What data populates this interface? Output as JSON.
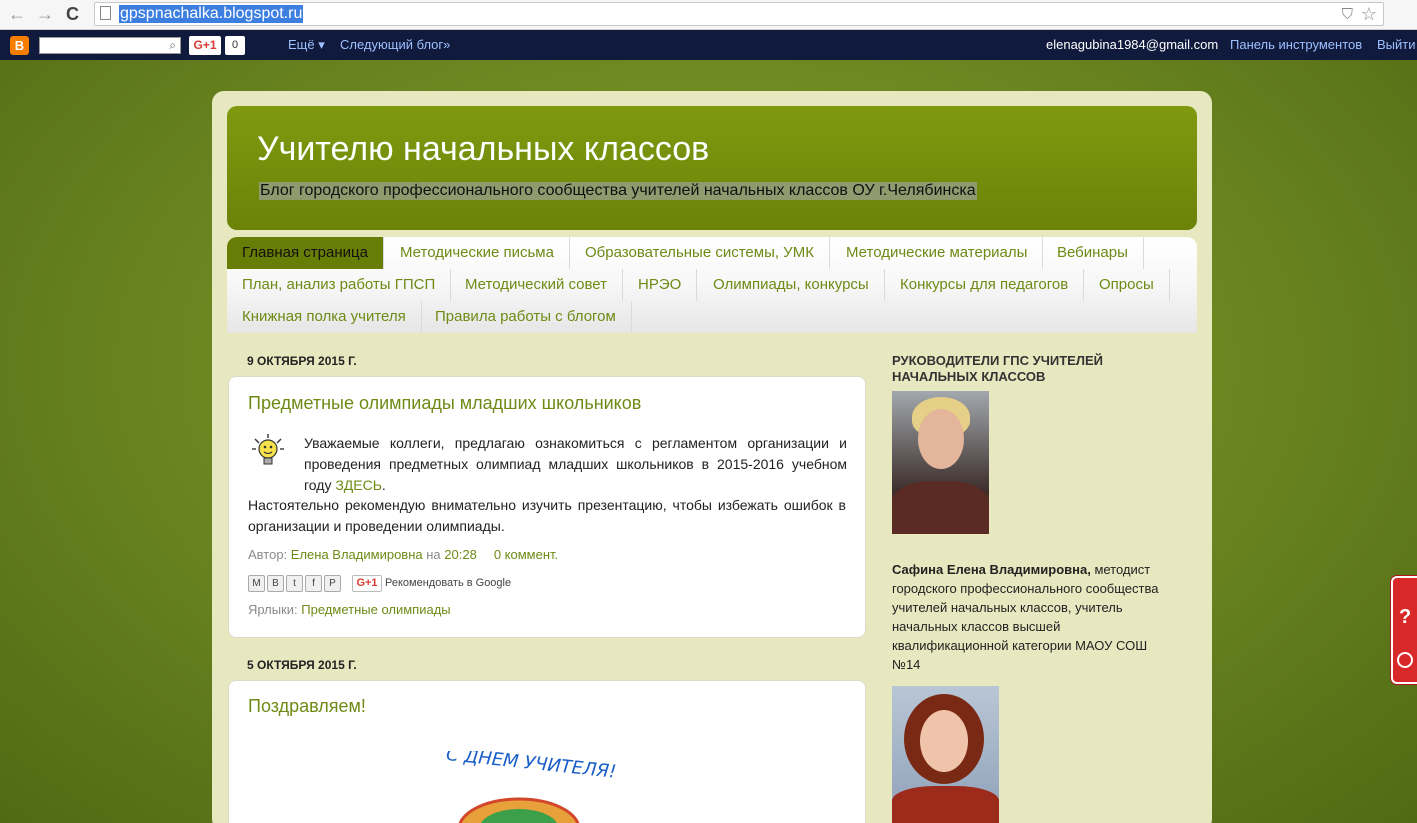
{
  "browser": {
    "url": "gpspnachalka.blogspot.ru",
    "back_icon": "←",
    "forward_icon": "→",
    "reload_icon": "C",
    "shield_icon": "⛉",
    "star_icon": "☆"
  },
  "navbar": {
    "logo": "B",
    "gplus": "G+1",
    "gcount": "0",
    "more": "Ещё ▾",
    "next_blog": "Следующий блог»",
    "email": "elenagubina1984@gmail.com",
    "dashboard": "Панель инструментов",
    "logout": "Выйти"
  },
  "header": {
    "title": "Учителю начальных классов",
    "description": "Блог городского профессионального сообщества учителей начальных классов ОУ г.Челябинска"
  },
  "tabs": [
    {
      "label": "Главная страница"
    },
    {
      "label": "Методические письма"
    },
    {
      "label": "Образовательные системы, УМК"
    },
    {
      "label": "Методические материалы"
    },
    {
      "label": "Вебинары"
    },
    {
      "label": "План, анализ работы ГПСП"
    },
    {
      "label": "Методический совет"
    },
    {
      "label": "НРЭО"
    },
    {
      "label": "Олимпиады, конкурсы"
    },
    {
      "label": "Конкурсы для педагогов"
    },
    {
      "label": "Опросы"
    },
    {
      "label": "Книжная полка учителя"
    },
    {
      "label": "Правила работы с блогом"
    }
  ],
  "posts": [
    {
      "date": "9 ОКТЯБРЯ 2015 Г.",
      "title": "Предметные олимпиады младших школьников",
      "p1": "Уважаемые коллеги, предлагаю ознакомиться с регламентом организации и проведения предметных олимпиад младших школьников в 2015-2016 учебном году ",
      "p1_link": "ЗДЕСЬ",
      "p1_end": ".",
      "p2": "Настоятельно рекомендую внимательно изучить презентацию, чтобы избежать ошибок в организации и проведении олимпиады.",
      "author_prefix": "Автор: ",
      "author": "Елена Владимировна",
      "at": " на ",
      "time": "20:28",
      "comments": "0 коммент.",
      "share_icons": [
        "M",
        "B",
        "t",
        "f",
        "P"
      ],
      "gplus": "G+1",
      "recommend": "Рекомендовать в Google",
      "labels_prefix": "Ярлыки: ",
      "label": "Предметные олимпиады"
    },
    {
      "date": "5 ОКТЯБРЯ 2015 Г.",
      "title": "Поздравляем!",
      "greeting_text": "С ДНЕМ УЧИТЕЛЯ!"
    }
  ],
  "sidebar": {
    "title": "РУКОВОДИТЕЛИ ГПС УЧИТЕЛЕЙ НАЧАЛЬНЫХ КЛАССОВ",
    "person1_name": "Сафина Елена Владимировна,",
    "person1_desc": " методист городского профессионального сообщества учителей начальных классов, учитель начальных классов высшей квалификационной категории МАОУ СОШ №14"
  },
  "float_widget": {
    "label": "?"
  }
}
